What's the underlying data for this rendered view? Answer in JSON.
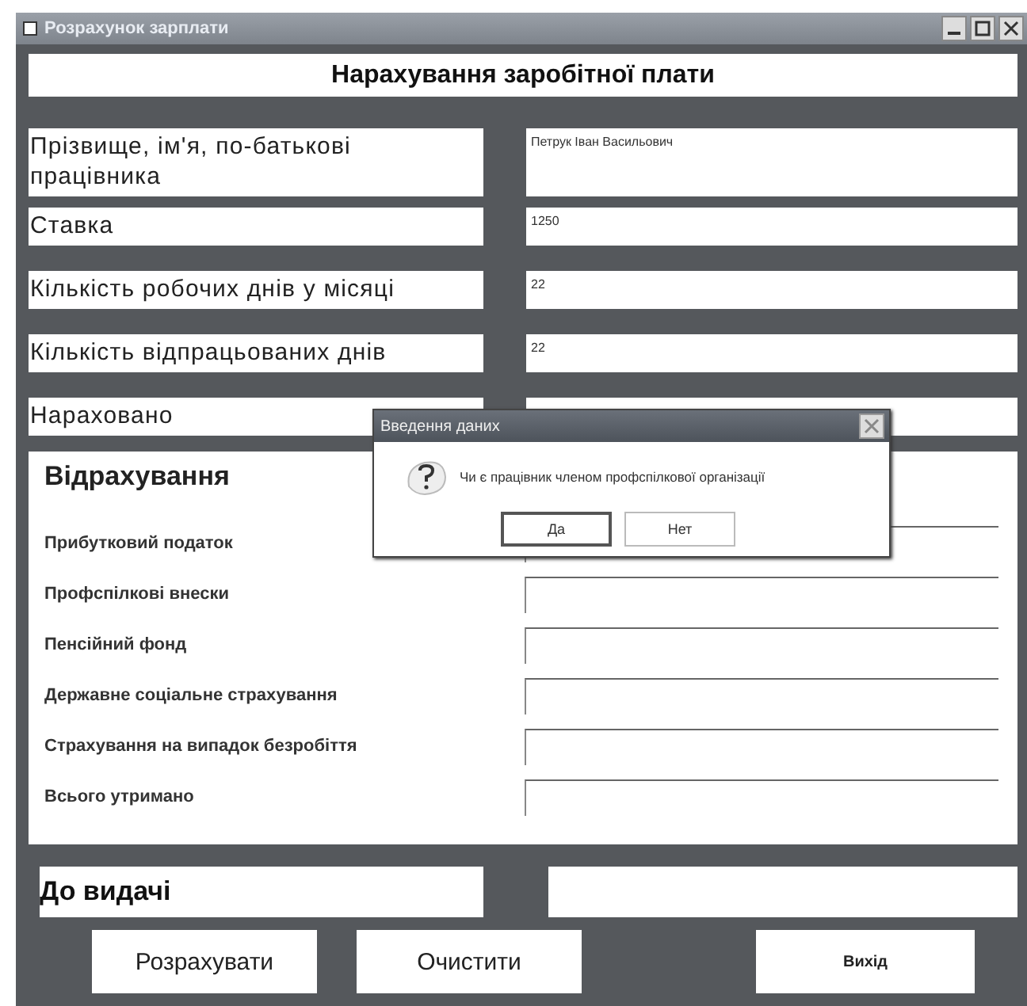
{
  "window": {
    "title": "Розрахунок зарплати"
  },
  "heading": "Нарахування заробітної плати",
  "fields": [
    {
      "label": "Прізвище, ім'я, по-батькові працівника",
      "value": "Петрук Іван Васильович"
    },
    {
      "label": "Ставка",
      "value": "1250"
    },
    {
      "label": "Кількість робочих днів у місяці",
      "value": "22"
    },
    {
      "label": "Кількість відпрацьованих днів",
      "value": "22"
    },
    {
      "label": "Нараховано"
    }
  ],
  "deductions": {
    "title": "Відрахування",
    "rows": [
      {
        "label": "Прибутковий податок"
      },
      {
        "label": "Профспілкові внески"
      },
      {
        "label": "Пенсійний фонд"
      },
      {
        "label": "Державне соціальне страхування"
      },
      {
        "label": "Страхування на випадок безробіття"
      },
      {
        "label": "Всього утримано"
      }
    ]
  },
  "payout": {
    "label": "До видачі"
  },
  "buttons": [
    {
      "label": "Розрахувати",
      "kind": "large"
    },
    {
      "label": "Очистити",
      "kind": "large"
    },
    {
      "label": "Вихід",
      "kind": "small"
    }
  ],
  "dialog": {
    "title": "Введення даних",
    "message": "Чи є працівник членом профспілкової організації",
    "buttons": [
      {
        "label": "Да",
        "selected": true
      },
      {
        "label": "Нет",
        "selected": false
      }
    ]
  }
}
